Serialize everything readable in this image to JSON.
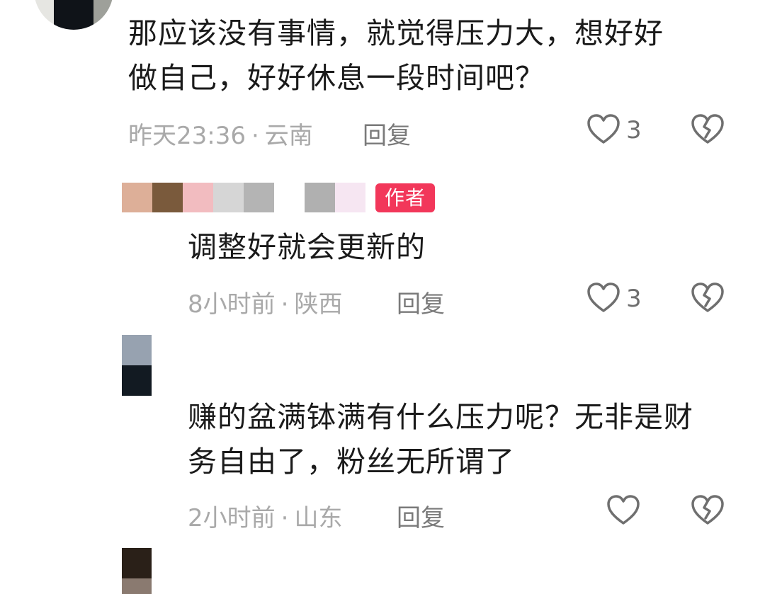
{
  "comments": [
    {
      "text": "那应该没有事情，就觉得压力大，想好好\n做自己，好好休息一段时间吧？",
      "time": "昨天23:36",
      "location": "云南",
      "reply": "回复",
      "likes": "3"
    },
    {
      "author_badge": "作者",
      "text": "调整好就会更新的",
      "time": "8小时前",
      "location": "陕西",
      "reply": "回复",
      "likes": "3"
    },
    {
      "text": "赚的盆满钵满有什么压力呢？无非是财\n务自由了，粉丝无所谓了",
      "time": "2小时前",
      "location": "山东",
      "reply": "回复",
      "likes": ""
    }
  ],
  "meta_separator": "·",
  "colors": {
    "text": "#1a1a1a",
    "meta": "#a9a9a9",
    "badge": "#f2375a",
    "icon": "#6f6f6f"
  },
  "icons": [
    "heart-outline-icon",
    "broken-heart-icon"
  ]
}
